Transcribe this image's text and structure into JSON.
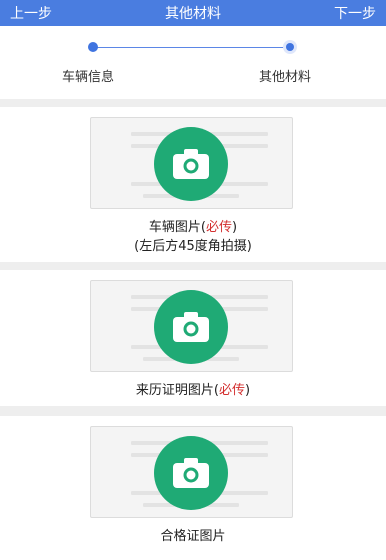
{
  "header": {
    "back": "上一步",
    "title": "其他材料",
    "next": "下一步"
  },
  "steps": [
    {
      "label": "车辆信息"
    },
    {
      "label": "其他材料"
    }
  ],
  "uploads": [
    {
      "label": "车辆图片",
      "required_prefix": "(",
      "required": "必传",
      "required_suffix": ")",
      "hint": "(左后方45度角拍摄)"
    },
    {
      "label": "来历证明图片",
      "required_prefix": "(",
      "required": "必传",
      "required_suffix": ")"
    },
    {
      "label": "合格证图片"
    }
  ],
  "colors": {
    "header": "#4a7de0",
    "camera": "#1faa75",
    "required": "#d32f2f"
  },
  "icons": {
    "upload": "camera-icon"
  }
}
